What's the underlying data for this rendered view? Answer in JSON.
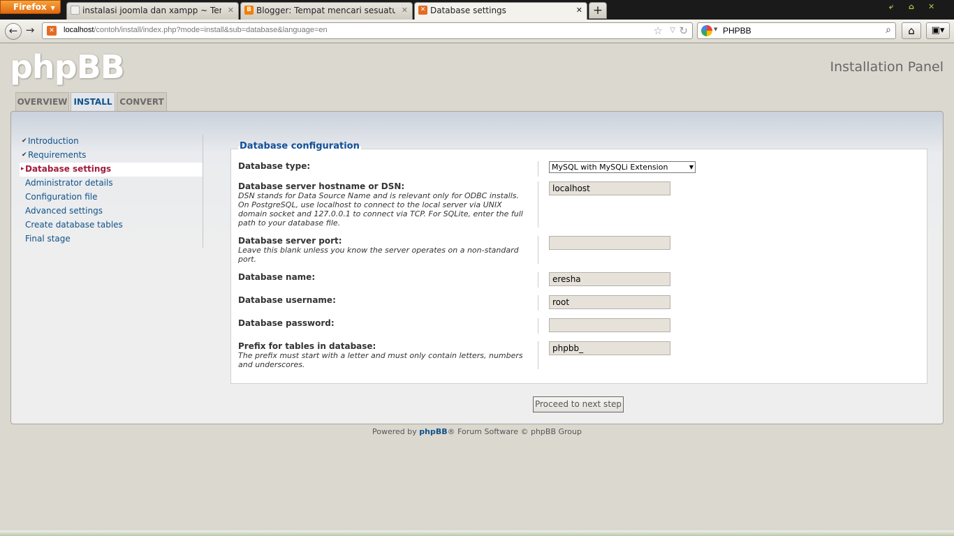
{
  "browser": {
    "menu_button": "Firefox",
    "tabs": [
      {
        "title": "instalasi joomla dan xampp ~ Tempat men...",
        "active": false
      },
      {
        "title": "Blogger: Tempat mencari sesuatu - Buat e...",
        "active": false
      },
      {
        "title": "Database settings",
        "active": true
      }
    ],
    "new_tab": "+",
    "url_host": "localhost",
    "url_path": "/contoh/install/index.php?mode=install&sub=database&language=en",
    "search_value": "PHPBB"
  },
  "page": {
    "logo": "phpBB",
    "panel_title": "Installation Panel",
    "tabs": [
      "OVERVIEW",
      "INSTALL",
      "CONVERT"
    ],
    "active_tab": "INSTALL",
    "menu": [
      {
        "label": "Introduction",
        "state": "done"
      },
      {
        "label": "Requirements",
        "state": "done"
      },
      {
        "label": "Database settings",
        "state": "active"
      },
      {
        "label": "Administrator details",
        "state": "todo"
      },
      {
        "label": "Configuration file",
        "state": "todo"
      },
      {
        "label": "Advanced settings",
        "state": "todo"
      },
      {
        "label": "Create database tables",
        "state": "todo"
      },
      {
        "label": "Final stage",
        "state": "todo"
      }
    ],
    "form": {
      "legend": "Database configuration",
      "db_type": {
        "label": "Database type:",
        "value": "MySQL with MySQLi Extension"
      },
      "db_host": {
        "label": "Database server hostname or DSN:",
        "help": "DSN stands for Data Source Name and is relevant only for ODBC installs. On PostgreSQL, use localhost to connect to the local server via UNIX domain socket and 127.0.0.1 to connect via TCP. For SQLite, enter the full path to your database file.",
        "value": "localhost"
      },
      "db_port": {
        "label": "Database server port:",
        "help": "Leave this blank unless you know the server operates on a non-standard port.",
        "value": ""
      },
      "db_name": {
        "label": "Database name:",
        "value": "eresha"
      },
      "db_user": {
        "label": "Database username:",
        "value": "root"
      },
      "db_pass": {
        "label": "Database password:",
        "value": ""
      },
      "db_prefix": {
        "label": "Prefix for tables in database:",
        "help": "The prefix must start with a letter and must only contain letters, numbers and underscores.",
        "value": "phpbb_"
      }
    },
    "proceed_button": "Proceed to next step",
    "footer": {
      "prefix": "Powered by ",
      "link": "phpBB",
      "suffix": "® Forum Software © phpBB Group"
    }
  }
}
